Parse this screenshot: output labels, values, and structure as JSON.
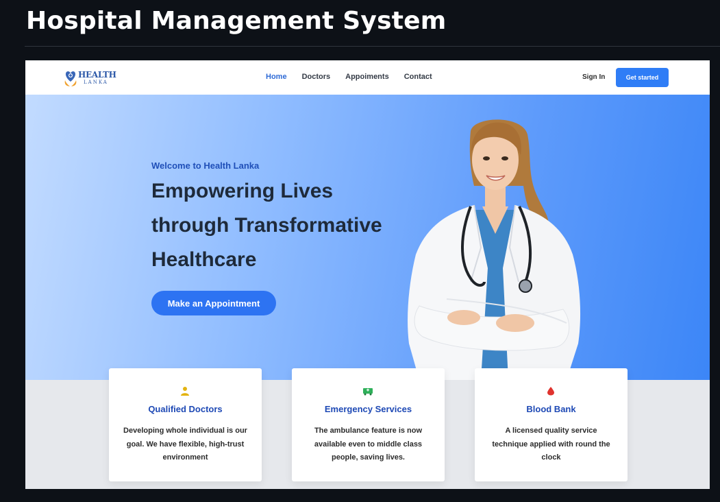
{
  "page": {
    "title": "Hospital Management System"
  },
  "navbar": {
    "logo": {
      "primary": "HEALTH",
      "secondary": "LANKA"
    },
    "links": [
      {
        "label": "Home",
        "active": true
      },
      {
        "label": "Doctors",
        "active": false
      },
      {
        "label": "Appoiments",
        "active": false
      },
      {
        "label": "Contact",
        "active": false
      }
    ],
    "sign_in": "Sign In",
    "get_started": "Get started"
  },
  "hero": {
    "welcome": "Welcome to Health Lanka",
    "title": "Empowering Lives through Transformative Healthcare",
    "cta": "Make an Appointment"
  },
  "cards": [
    {
      "icon": "doctor-icon",
      "title": "Qualified Doctors",
      "text": "Developing whole individual is our goal. We have flexible, high-trust environment"
    },
    {
      "icon": "ambulance-icon",
      "title": "Emergency Services",
      "text": "The ambulance feature is now available even to middle class people, saving lives."
    },
    {
      "icon": "blood-drop-icon",
      "title": "Blood Bank",
      "text": "A licensed quality service technique applied with round the clock"
    }
  ],
  "colors": {
    "accent": "#2f7df6",
    "heading_blue": "#1e49b5",
    "page_bg": "#0d1117"
  }
}
